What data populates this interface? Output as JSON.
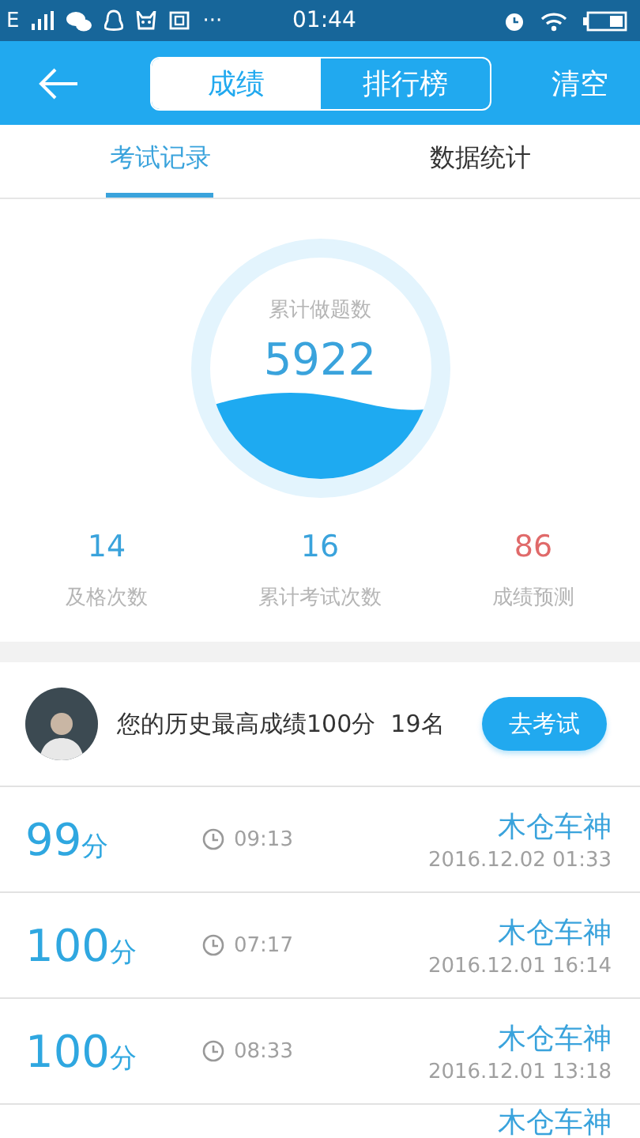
{
  "status_bar": {
    "network": "E",
    "more": "···",
    "time": "01:44"
  },
  "header": {
    "segments": [
      {
        "label": "成绩",
        "selected": true
      },
      {
        "label": "排行榜",
        "selected": false
      }
    ],
    "action": "清空"
  },
  "tabs": [
    {
      "label": "考试记录",
      "selected": true
    },
    {
      "label": "数据统计",
      "selected": false
    }
  ],
  "summary": {
    "caption": "累计做题数",
    "value": "5922"
  },
  "stats": [
    {
      "value": "14",
      "label": "及格次数",
      "color": "#3aa3dc"
    },
    {
      "value": "16",
      "label": "累计考试次数",
      "color": "#3aa3dc"
    },
    {
      "value": "86",
      "label": "成绩预测",
      "color": "#e06a6a"
    }
  ],
  "best": {
    "text": "您的历史最高成绩100分  19名",
    "button": "去考试"
  },
  "records": [
    {
      "score": "99",
      "unit": "分",
      "duration": "09:13",
      "name": "木仓车神",
      "date": "2016.12.02  01:33"
    },
    {
      "score": "100",
      "unit": "分",
      "duration": "07:17",
      "name": "木仓车神",
      "date": "2016.12.01  16:14"
    },
    {
      "score": "100",
      "unit": "分",
      "duration": "08:33",
      "name": "木仓车神",
      "date": "2016.12.01  13:18"
    },
    {
      "name": "木仓车神"
    }
  ]
}
